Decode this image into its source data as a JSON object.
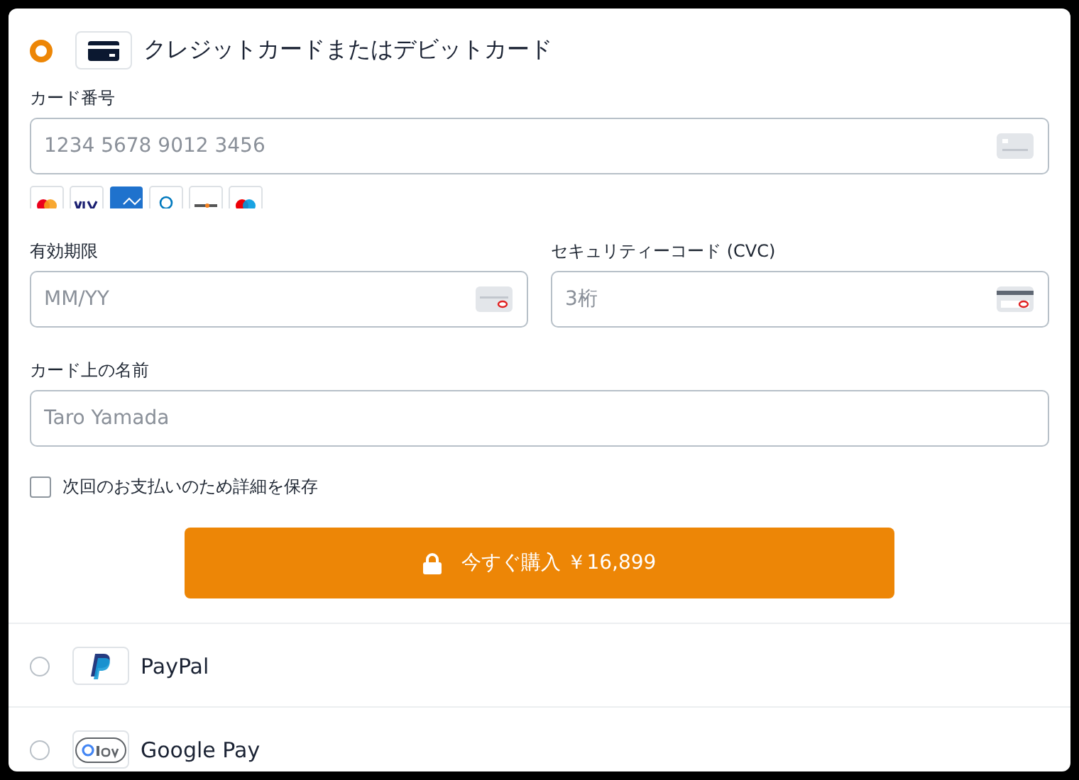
{
  "methods": [
    {
      "kind": "card",
      "label": "クレジットカードまたはデビットカード",
      "selected": true,
      "card_number": {
        "label": "カード番号",
        "placeholder": "1234 5678 9012 3456"
      },
      "expiry": {
        "label": "有効期限",
        "placeholder": "MM/YY"
      },
      "cvc": {
        "label": "セキュリティーコード (CVC)",
        "placeholder": "3桁"
      },
      "name": {
        "label": "カード上の名前",
        "placeholder": "Taro Yamada"
      },
      "save": {
        "label": "次回のお支払いのため詳細を保存",
        "checked": false
      },
      "pay_button": "今すぐ購入 ￥16,899"
    },
    {
      "kind": "paypal",
      "label": "PayPal",
      "selected": false
    },
    {
      "kind": "gpay",
      "label": "Google Pay",
      "selected": false
    }
  ]
}
